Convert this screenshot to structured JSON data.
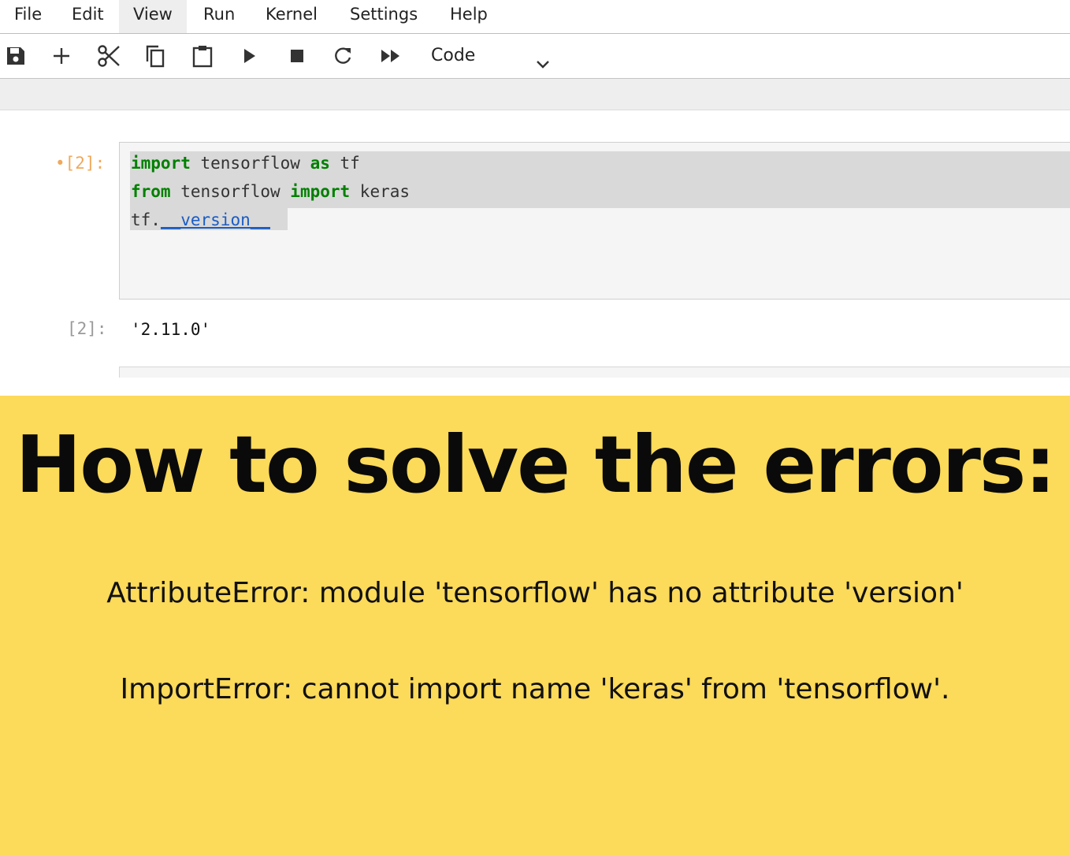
{
  "menu": {
    "items": [
      {
        "label": "File"
      },
      {
        "label": "Edit"
      },
      {
        "label": "View"
      },
      {
        "label": "Run"
      },
      {
        "label": "Kernel"
      },
      {
        "label": "Settings"
      },
      {
        "label": "Help"
      }
    ],
    "active": "View"
  },
  "toolbar": {
    "icons": [
      "save-icon",
      "add-cell-icon",
      "cut-icon",
      "copy-icon",
      "paste-icon",
      "run-icon",
      "stop-icon",
      "restart-icon",
      "run-all-icon"
    ],
    "cell_type": "Code"
  },
  "cell": {
    "in_prompt": "•[2]:",
    "code": {
      "line1": {
        "kw1": "import",
        "mid": " tensorflow ",
        "kw2": "as",
        "end": " tf"
      },
      "line2": {
        "kw1": "from",
        "mid": " tensorflow ",
        "kw2": "import",
        "end": " keras"
      },
      "line3": {
        "obj": "tf.",
        "attr": "__version__"
      }
    },
    "out_prompt": "[2]:",
    "output": "'2.11.0'"
  },
  "banner": {
    "headline": "How to solve the errors:",
    "error1": "AttributeError: module 'tensorflow' has no attribute 'version'",
    "error2": "ImportError: cannot import name 'keras' from 'tensorflow'."
  },
  "colors": {
    "banner_bg": "#fcda5a",
    "keyword": "#008000",
    "attribute": "#1a5cc4",
    "in_prompt": "#f0a85a"
  }
}
